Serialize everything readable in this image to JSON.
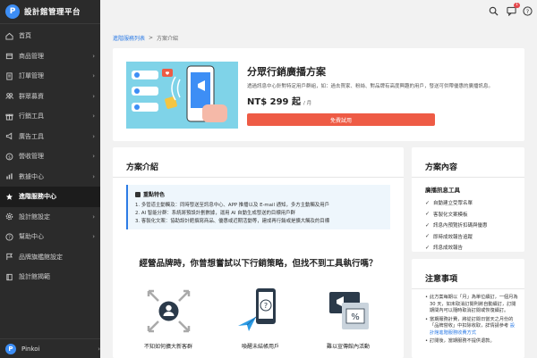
{
  "app": {
    "title": "設計館管理平台",
    "logo_letter": "P"
  },
  "sidebar": {
    "items": [
      {
        "label": "首頁",
        "icon": "home-icon",
        "has_arrow": false,
        "active": false
      },
      {
        "label": "商品管理",
        "icon": "box-icon",
        "has_arrow": true,
        "active": false
      },
      {
        "label": "訂單管理",
        "icon": "list-icon",
        "has_arrow": true,
        "active": false
      },
      {
        "label": "群眾募資",
        "icon": "group-icon",
        "has_arrow": true,
        "active": false
      },
      {
        "label": "行銷工具",
        "icon": "gift-icon",
        "has_arrow": true,
        "active": false
      },
      {
        "label": "廣告工具",
        "icon": "megaphone-icon",
        "has_arrow": true,
        "active": false
      },
      {
        "label": "營收管理",
        "icon": "coin-icon",
        "has_arrow": true,
        "active": false
      },
      {
        "label": "數據中心",
        "icon": "chart-icon",
        "has_arrow": true,
        "active": false
      },
      {
        "label": "進階服務中心",
        "icon": "star-icon",
        "has_arrow": false,
        "active": true
      },
      {
        "label": "設計館設定",
        "icon": "gear-icon",
        "has_arrow": true,
        "active": false
      },
      {
        "label": "幫助中心",
        "icon": "help-icon",
        "has_arrow": true,
        "active": false
      },
      {
        "label": "品牌旗艦館設定",
        "icon": "flag-icon",
        "has_arrow": false,
        "active": false
      },
      {
        "label": "設計館揭範",
        "icon": "book-icon",
        "has_arrow": false,
        "active": false
      }
    ],
    "user": {
      "name": "Pinkoi",
      "avatar_letter": "P"
    }
  },
  "topbar": {
    "notification_count": "1"
  },
  "breadcrumb": {
    "parent": "進階服務列表",
    "separator": ">",
    "current": "方案介紹"
  },
  "hero": {
    "title": "分眾行銷廣播方案",
    "description": "透過訊息中心針對特定用戶群組，如：過去買家、粉絲、對品牌有高度興趣的用戶，發送可供帶優惠的廣播訊息。",
    "price": "NT$ 299 起",
    "price_unit": "/ 月",
    "cta_label": "免費試用"
  },
  "intro": {
    "heading": "方案介紹",
    "feature_title": "重點特色",
    "features": [
      "1. 多管道主動觸及：同時發送至訊息中心、APP 推播以及 E-mail 通知，多方主動觸及用戶",
      "2. AI 智能分群：系統將預設計劃數據，運用 AI 自動生成發送的目標用戶群",
      "3. 客製化文案：協助設計館撰寫商品、優惠或近期活動等，建成再行銷或是擴大觸及的目標"
    ],
    "question": "經營品牌時，你曾想嘗試以下行銷策略，但找不到工具執行嗎？",
    "scenarios": [
      {
        "label": "不知如何擴大新客群",
        "icon": "expand-users-icon"
      },
      {
        "label": "喚醒未結帳用戶",
        "icon": "phone-question-icon"
      },
      {
        "label": "難以宣傳館內活動",
        "icon": "promo-screen-icon"
      }
    ]
  },
  "contents": {
    "heading": "方案內容",
    "subheading": "廣播訊息工具",
    "items": [
      "自動建立受眾名單",
      "客製化文案模板",
      "訊息內預覽折扣碼與優惠",
      "即時成效報告追蹤",
      "訊息成效報告"
    ]
  },
  "notes": {
    "heading": "注意事項",
    "items": [
      "此方案每期以「月」為單位續訂，一個月為 30 天，如未取消訂閱則將自動續訂，訂閱期間內可以隨時取消訂閱或恢復續訂。",
      "當期服務計費，將從訂閱日當天之月份的「品牌營收」中扣除收取，詳情請參考"
    ],
    "link_text": "設計館進階服務收費方式",
    "trailing": "訂閱後，當期服務不提供退款。"
  },
  "colors": {
    "sidebar_bg": "#2b2b2b",
    "accent": "#2c7be5",
    "cta": "#ee5b45",
    "hero_art_bg": "#7fd3e8"
  }
}
